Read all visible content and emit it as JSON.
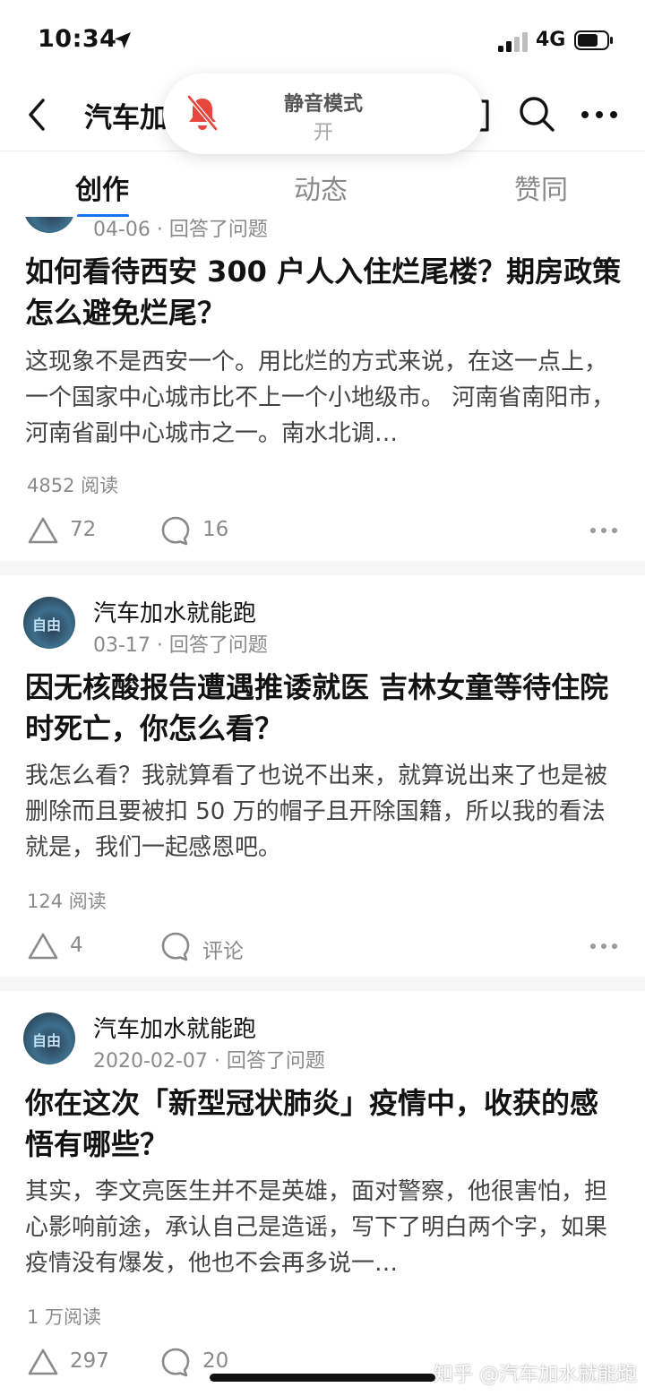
{
  "status_bar": {
    "time": "10:34",
    "network": "4G"
  },
  "nav": {
    "title": "汽车加"
  },
  "silent_mode": {
    "title": "静音模式",
    "state": "开"
  },
  "tabs": [
    {
      "label": "创作",
      "active": true
    },
    {
      "label": "动态",
      "active": false
    },
    {
      "label": "赞同",
      "active": false
    }
  ],
  "posts": [
    {
      "meta": "04-06 · 回答了问题",
      "title": "如何看待西安 300 户人入住烂尾楼？期房政策怎么避免烂尾？",
      "excerpt": "这现象不是西安一个。用比烂的方式来说，在这一点上，一个国家中心城市比不上一个小地级市。 河南省南阳市，河南省副中心城市之一。南水北调…",
      "reads": "4852 阅读",
      "upvotes": "72",
      "comments": "16"
    },
    {
      "author": "汽车加水就能跑",
      "meta": "03-17 · 回答了问题",
      "title": "因无核酸报告遭遇推诿就医 吉林女童等待住院时死亡，你怎么看？",
      "excerpt": "我怎么看？我就算看了也说不出来，就算说出来了也是被删除而且要被扣 50 万的帽子且开除国籍，所以我的看法就是，我们一起感恩吧。",
      "reads": "124 阅读",
      "upvotes": "4",
      "comments": "评论"
    },
    {
      "author": "汽车加水就能跑",
      "meta": "2020-02-07 · 回答了问题",
      "title": "你在这次「新型冠状肺炎」疫情中，收获的感悟有哪些？",
      "excerpt": "其实，李文亮医生并不是英雄，面对警察，他很害怕，担心影响前途，承认自己是造谣，写下了明白两个字，如果疫情没有爆发，他也不会再多说一…",
      "reads": "1 万阅读",
      "upvotes": "297",
      "comments": "20"
    }
  ],
  "avatar_text": "自由",
  "watermark": "知乎 @汽车加水就能跑",
  "colors": {
    "accent": "#1772f6",
    "bell": "#e8453c",
    "text": "#121212",
    "secondary": "#8a8a8a"
  }
}
